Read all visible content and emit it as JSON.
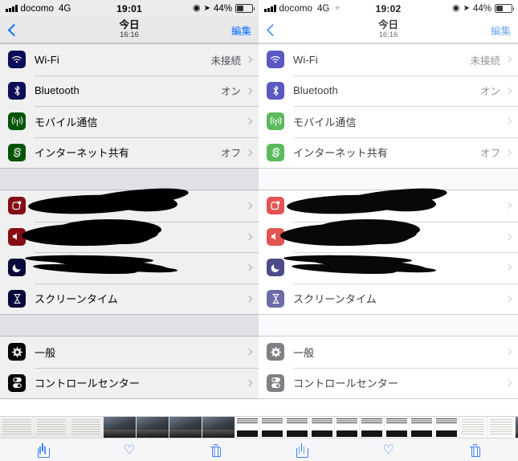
{
  "app": {
    "name": "Photos",
    "view": "photo-comparison"
  },
  "panes": [
    {
      "id": "left",
      "status": {
        "carrier": "docomo",
        "network": "4G",
        "spinner": "",
        "time": "19:01",
        "dnd_icon": "do-not-disturb-icon",
        "location_icon": "location-arrow-icon",
        "battery_percent": "44%",
        "battery_level": 44
      },
      "nav": {
        "back_icon": "chevron-left-icon",
        "title": "今日",
        "subtitle": "16:16",
        "edit_label": "編集"
      },
      "groups": [
        {
          "rows": [
            {
              "icon": "wifi-icon",
              "icon_glyph": "≋",
              "icon_color": "#1b1b55",
              "label": "Wi-Fi",
              "value": "未接続",
              "redacted": false
            },
            {
              "icon": "bluetooth-icon",
              "icon_glyph": "✱",
              "icon_color": "#1b1b55",
              "label": "Bluetooth",
              "value": "オン",
              "redacted": false
            },
            {
              "icon": "cellular-icon",
              "icon_glyph": "Ψ",
              "icon_color": "#1d5c1d",
              "label": "モバイル通信",
              "value": "",
              "redacted": false
            },
            {
              "icon": "hotspot-icon",
              "icon_glyph": "❂",
              "icon_color": "#1d5c1d",
              "label": "インターネット共有",
              "value": "オフ",
              "redacted": false
            }
          ]
        },
        {
          "rows": [
            {
              "icon": "notifications-icon",
              "icon_glyph": "◖",
              "icon_color": "#7d1f24",
              "label": "",
              "value": "",
              "redacted": true
            },
            {
              "icon": "sounds-icon",
              "icon_glyph": "◀",
              "icon_color": "#7d1f24",
              "label": "",
              "value": "",
              "redacted": true
            },
            {
              "icon": "do-not-disturb-icon",
              "icon_glyph": "☾",
              "icon_color": "#15153c",
              "label": "",
              "value": "",
              "redacted": true
            },
            {
              "icon": "screen-time-icon",
              "icon_glyph": "⧗",
              "icon_color": "#15153c",
              "label": "スクリーンタイム",
              "value": "",
              "redacted": false
            }
          ]
        },
        {
          "rows": [
            {
              "icon": "general-gear-icon",
              "icon_glyph": "✺",
              "icon_color": "#0d0d0d",
              "label": "一般",
              "value": "",
              "redacted": false
            },
            {
              "icon": "control-center-icon",
              "icon_glyph": "⦿",
              "icon_color": "#0d0d0d",
              "label": "コントロールセンター",
              "value": "",
              "redacted": false
            }
          ]
        }
      ],
      "toolbar": {
        "share_icon": "share-icon",
        "favorite_icon": "heart-icon",
        "delete_icon": "trash-icon"
      }
    },
    {
      "id": "right",
      "status": {
        "carrier": "docomo",
        "network": "4G",
        "spinner": "✳",
        "time": "19:02",
        "dnd_icon": "do-not-disturb-icon",
        "location_icon": "location-arrow-icon",
        "battery_percent": "44%",
        "battery_level": 44
      },
      "nav": {
        "back_icon": "chevron-left-icon",
        "title": "今日",
        "subtitle": "16:16",
        "edit_label": "編集"
      },
      "groups": [
        {
          "rows": [
            {
              "icon": "wifi-icon",
              "icon_glyph": "≋",
              "icon_color": "#5856c6",
              "label": "Wi-Fi",
              "value": "未接続",
              "redacted": false
            },
            {
              "icon": "bluetooth-icon",
              "icon_glyph": "✱",
              "icon_color": "#5856c6",
              "label": "Bluetooth",
              "value": "オン",
              "redacted": false
            },
            {
              "icon": "cellular-icon",
              "icon_glyph": "Ψ",
              "icon_color": "#56b856",
              "label": "モバイル通信",
              "value": "",
              "redacted": false
            },
            {
              "icon": "hotspot-icon",
              "icon_glyph": "❂",
              "icon_color": "#56b856",
              "label": "インターネット共有",
              "value": "オフ",
              "redacted": false
            }
          ]
        },
        {
          "rows": [
            {
              "icon": "notifications-icon",
              "icon_glyph": "◖",
              "icon_color": "#e8514f",
              "label": "",
              "value": "",
              "redacted": true
            },
            {
              "icon": "sounds-icon",
              "icon_glyph": "◀",
              "icon_color": "#e8514f",
              "label": "",
              "value": "",
              "redacted": true
            },
            {
              "icon": "do-not-disturb-icon",
              "icon_glyph": "☾",
              "icon_color": "#4a4a8a",
              "label": "",
              "value": "",
              "redacted": true
            },
            {
              "icon": "screen-time-icon",
              "icon_glyph": "⧗",
              "icon_color": "#6a6aa8",
              "label": "スクリーンタイム",
              "value": "",
              "redacted": false
            }
          ]
        },
        {
          "rows": [
            {
              "icon": "general-gear-icon",
              "icon_glyph": "✺",
              "icon_color": "#7c7c82",
              "label": "一般",
              "value": "",
              "redacted": false
            },
            {
              "icon": "control-center-icon",
              "icon_glyph": "⦿",
              "icon_color": "#7c7c82",
              "label": "コントロールセンター",
              "value": "",
              "redacted": false
            }
          ]
        }
      ],
      "toolbar": {
        "share_icon": "share-icon",
        "favorite_icon": "heart-icon",
        "delete_icon": "trash-icon"
      }
    }
  ],
  "filmstrip": {
    "thumbnails": [
      "doc",
      "doc",
      "doc",
      "photo",
      "photo",
      "photo",
      "photo",
      "ss",
      "ss",
      "ss",
      "ss",
      "ss",
      "ss",
      "ss",
      "ss",
      "ss",
      "web",
      "web",
      "photo",
      "photo",
      "photo",
      "ss",
      "ss",
      "ss",
      "ss",
      "ss",
      "ss",
      "ss",
      "ss",
      "web",
      "web",
      "photo"
    ]
  },
  "colors": {
    "accent_blue": "#3b82f6",
    "list_background": "#efeff4",
    "row_background": "#ffffff",
    "separator": "#d7d7db"
  },
  "icons": {
    "heart": "♡"
  }
}
